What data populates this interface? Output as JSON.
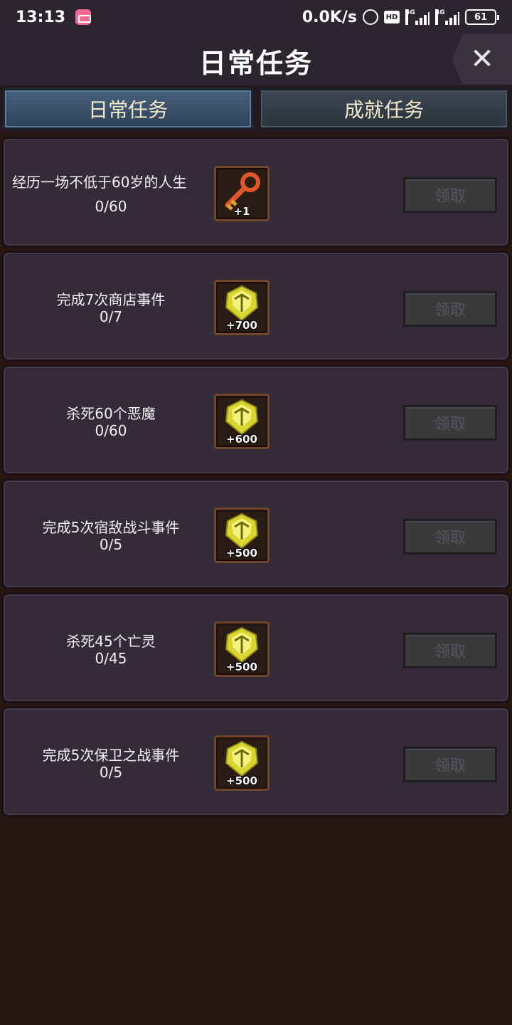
{
  "status_bar": {
    "time": "13:13",
    "net_speed": "0.0K/s",
    "hd": "HD",
    "signal1": "4G",
    "signal2": "4G",
    "battery": "61"
  },
  "header": {
    "title": "日常任务",
    "close_label": "✕"
  },
  "tabs": [
    {
      "label": "日常任务",
      "active": true
    },
    {
      "label": "成就任务",
      "active": false
    }
  ],
  "tasks": [
    {
      "title": "经历一场不低于60岁的人生",
      "progress": "0/60",
      "reward_type": "key-icon",
      "reward_amount": "+1",
      "claim_label": "领取"
    },
    {
      "title": "完成7次商店事件",
      "progress": "0/7",
      "reward_type": "gold-crest-icon",
      "reward_amount": "+700",
      "claim_label": "领取"
    },
    {
      "title": "杀死60个恶魔",
      "progress": "0/60",
      "reward_type": "gold-crest-icon",
      "reward_amount": "+600",
      "claim_label": "领取"
    },
    {
      "title": "完成5次宿敌战斗事件",
      "progress": "0/5",
      "reward_type": "gold-crest-icon",
      "reward_amount": "+500",
      "claim_label": "领取"
    },
    {
      "title": "杀死45个亡灵",
      "progress": "0/45",
      "reward_type": "gold-crest-icon",
      "reward_amount": "+500",
      "claim_label": "领取"
    },
    {
      "title": "完成5次保卫之战事件",
      "progress": "0/5",
      "reward_type": "gold-crest-icon",
      "reward_amount": "+500",
      "claim_label": "领取"
    }
  ],
  "colors": {
    "background": "#271612",
    "card": "#352a39",
    "tab_active": "#46607c",
    "tab_inactive": "#3c4752",
    "tab_text": "#f3eaca",
    "claim_disabled_text": "#56565a",
    "gold": "#d9d431"
  }
}
